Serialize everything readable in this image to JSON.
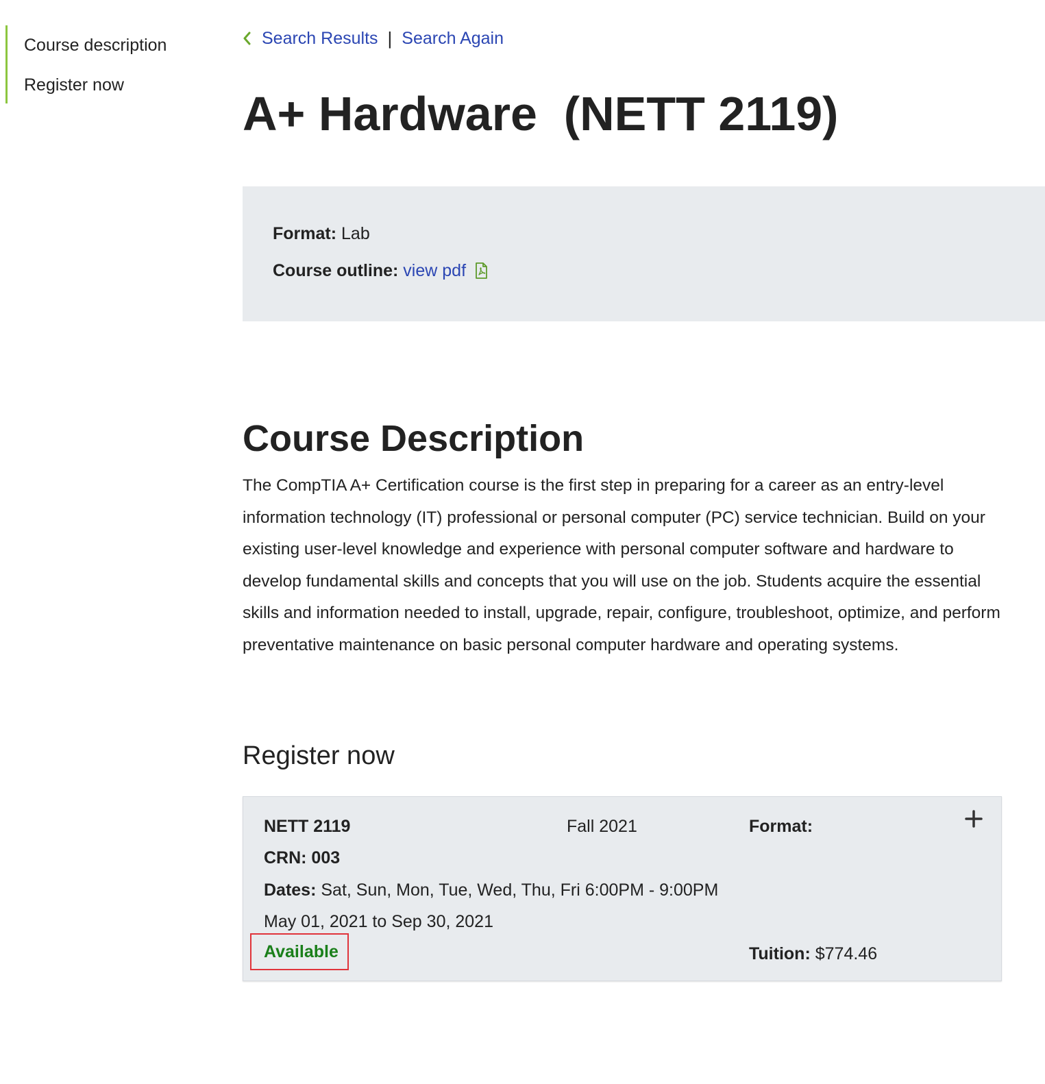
{
  "sidebar": {
    "items": [
      {
        "label": "Course description"
      },
      {
        "label": "Register now"
      }
    ]
  },
  "breadcrumb": {
    "back_icon": "chevron-left-icon",
    "search_results": "Search Results",
    "separator": "|",
    "search_again": "Search Again"
  },
  "page_title": "A+ Hardware  (NETT 2119)",
  "info": {
    "format_label": "Format:",
    "format_value": "Lab",
    "outline_label": "Course outline:",
    "outline_link": "view pdf",
    "outline_icon": "pdf-file-icon"
  },
  "description": {
    "title": "Course Description",
    "body": "The CompTIA A+ Certification course is the first step in preparing for a career as an entry-level information technology (IT) professional or personal computer (PC) service technician. Build on your existing user-level knowledge and experience with personal computer software and hardware to develop fundamental skills and concepts that you will use on the job. Students acquire the essential skills and information needed to install, upgrade, repair, configure, troubleshoot, optimize, and perform preventative maintenance on basic personal computer hardware and operating systems."
  },
  "register": {
    "title": "Register now",
    "section": {
      "course_code": "NETT 2119",
      "term": "Fall 2021",
      "format_label": "Format:",
      "crn": "CRN: 003",
      "dates_label": "Dates:",
      "dates_value": " Sat, Sun, Mon, Tue, Wed, Thu, Fri 6:00PM - 9:00PM",
      "date_range": "May 01, 2021 to Sep 30, 2021",
      "status": "Available",
      "tuition_label": "Tuition:",
      "tuition_value": " $774.46",
      "expand_icon": "plus-icon"
    }
  },
  "colors": {
    "accent_green": "#8cc63f",
    "link_blue": "#2b46b3",
    "status_green": "#1a7f1a",
    "highlight_red": "#e0333a",
    "panel_gray": "#e8ebee"
  }
}
